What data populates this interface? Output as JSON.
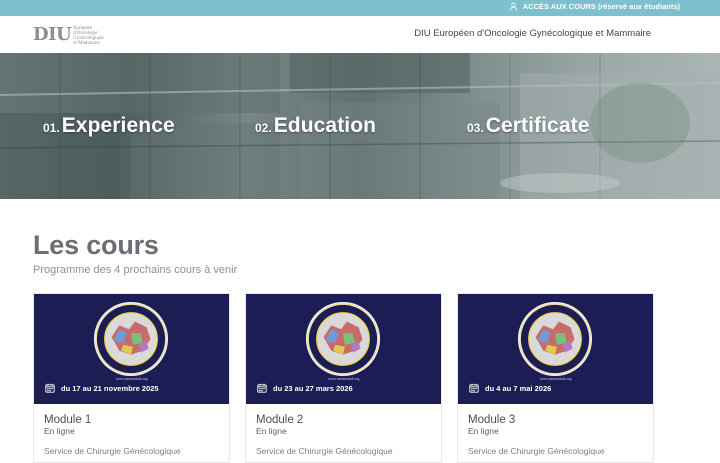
{
  "topbar": {
    "access_label": "ACCÈS AUX COURS (réservé aux étudiants)",
    "icon": "user-icon",
    "background": "#7fc0cf"
  },
  "header": {
    "logo_mark": "DIU",
    "logo_lines": [
      "Européen",
      "d'Oncologie",
      "Gynécologique",
      "et Mammaire"
    ],
    "nav_title": "DIU Européen d'Oncologie Gynécologique et Mammaire"
  },
  "hero": {
    "items": [
      {
        "number": "01.",
        "label": "Experience"
      },
      {
        "number": "02.",
        "label": "Education"
      },
      {
        "number": "03.",
        "label": "Certificate"
      }
    ]
  },
  "courses": {
    "title": "Les cours",
    "subtitle": "Programme des 4 prochains cours à venir",
    "cards": [
      {
        "date": "du 17 au 21 novembre 2025",
        "module": "Module 1",
        "mode": "En ligne",
        "service": "Service de Chirurgie Génécologique",
        "image_url_text": "www.mausonud.org"
      },
      {
        "date": "du 23 au 27 mars 2026",
        "module": "Module 2",
        "mode": "En ligne",
        "service": "Service de Chirurgie Génécologique",
        "image_url_text": "www.mausonud.org"
      },
      {
        "date": "du 4 au 7 mai 2026",
        "module": "Module 3",
        "mode": "En ligne",
        "service": "Service de Chirurgie Génécologique",
        "image_url_text": "www.mausonud.org"
      }
    ],
    "card_image_background": "#1d1d56"
  }
}
